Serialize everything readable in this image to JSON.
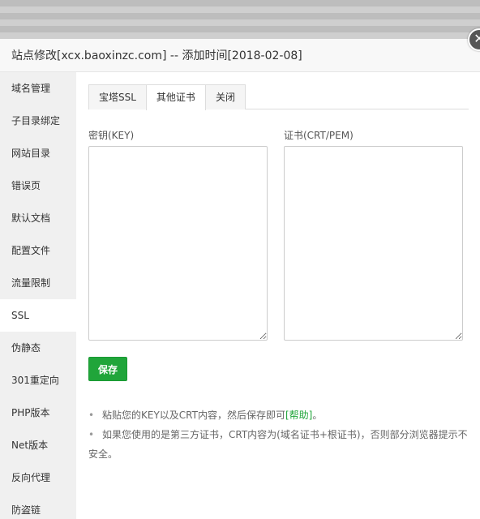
{
  "modal": {
    "title": "站点修改[xcx.baoxinzc.com] -- 添加时间[2018-02-08]",
    "close_glyph": "✕"
  },
  "sidebar": {
    "items": [
      {
        "label": "域名管理"
      },
      {
        "label": "子目录绑定"
      },
      {
        "label": "网站目录"
      },
      {
        "label": "错误页"
      },
      {
        "label": "默认文档"
      },
      {
        "label": "配置文件"
      },
      {
        "label": "流量限制"
      },
      {
        "label": "SSL",
        "active": true
      },
      {
        "label": "伪静态"
      },
      {
        "label": "301重定向"
      },
      {
        "label": "PHP版本"
      },
      {
        "label": "Net版本"
      },
      {
        "label": "反向代理"
      },
      {
        "label": "防盗链"
      }
    ]
  },
  "tabs": [
    {
      "label": "宝塔SSL"
    },
    {
      "label": "其他证书",
      "active": true
    },
    {
      "label": "关闭"
    }
  ],
  "form": {
    "key_label": "密钥(KEY)",
    "key_value": "",
    "crt_label": "证书(CRT/PEM)",
    "crt_value": "",
    "save_label": "保存"
  },
  "tips": {
    "tip1_text": "粘贴您的KEY以及CRT内容，然后保存即可",
    "tip1_link": "[帮助]",
    "tip1_end": "。",
    "tip2_text": "如果您使用的是第三方证书，CRT内容为(域名证书+根证书)，否则部分浏览器提示不安全。"
  },
  "colors": {
    "accent": "#20a53a",
    "sidebar_bg": "#f0f0f0"
  }
}
